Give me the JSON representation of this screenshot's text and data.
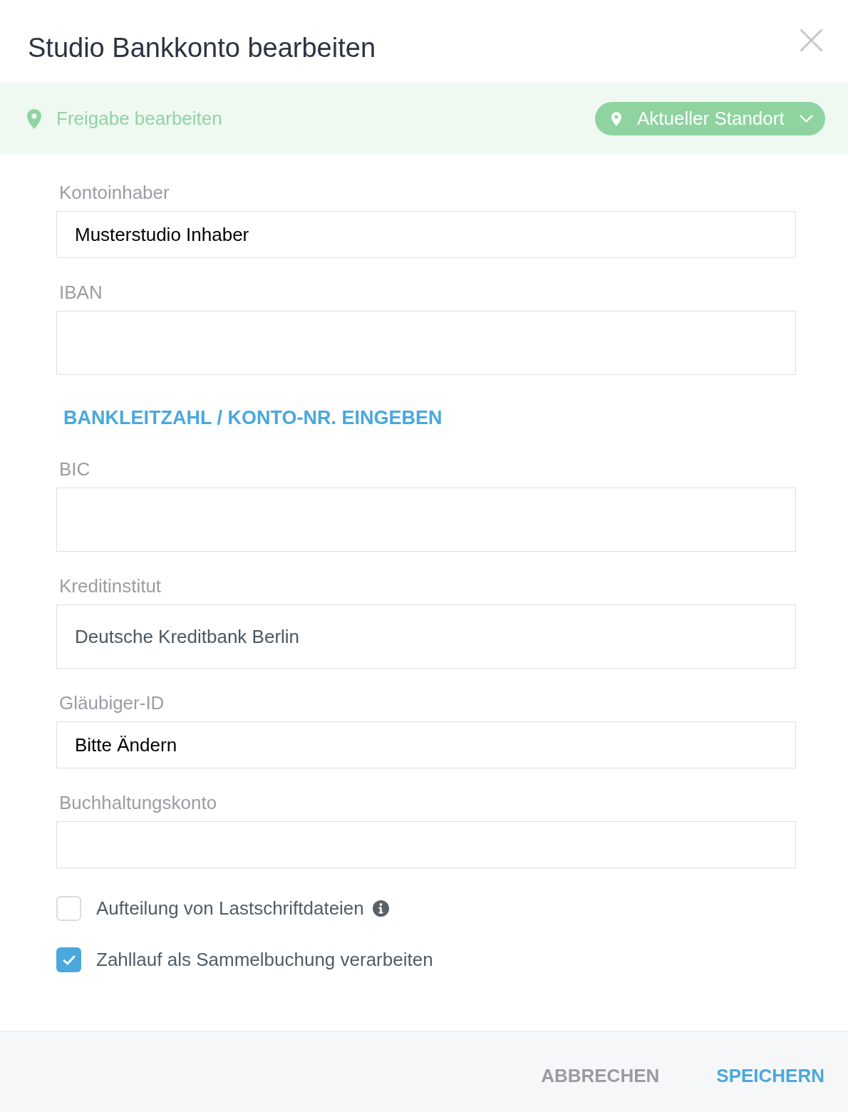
{
  "dialog": {
    "title": "Studio Bankkonto bearbeiten"
  },
  "sharing_bar": {
    "label": "Freigabe bearbeiten",
    "location_button": "Aktueller Standort"
  },
  "form_items": [
    {
      "kind": "field",
      "label": "Kontoinhaber",
      "value": "Musterstudio Inhaber",
      "disabled": false
    },
    {
      "kind": "tallfield",
      "label": "IBAN"
    },
    {
      "kind": "link",
      "label": "BANKLEITZAHL / KONTO-NR. EINGEBEN"
    },
    {
      "kind": "tallfield",
      "label": "BIC"
    },
    {
      "kind": "tallfield",
      "label": "Kreditinstitut",
      "value": "Deutsche Kreditbank Berlin",
      "disabled": true
    },
    {
      "kind": "field",
      "label": "Gläubiger-ID",
      "value": "Bitte Ändern",
      "disabled": false
    },
    {
      "kind": "field",
      "label": "Buchhaltungskonto"
    }
  ],
  "options": [
    {
      "label": "Aufteilung von Lastschriftdateien",
      "checked": false,
      "info": true
    },
    {
      "label": "Zahllauf als Sammelbuchung verarbeiten",
      "checked": true,
      "info": false
    }
  ],
  "footer": {
    "buttons": [
      {
        "label": "ABBRECHEN",
        "kind": "secondary"
      },
      {
        "label": "SPEICHERN",
        "kind": "primary"
      }
    ]
  }
}
